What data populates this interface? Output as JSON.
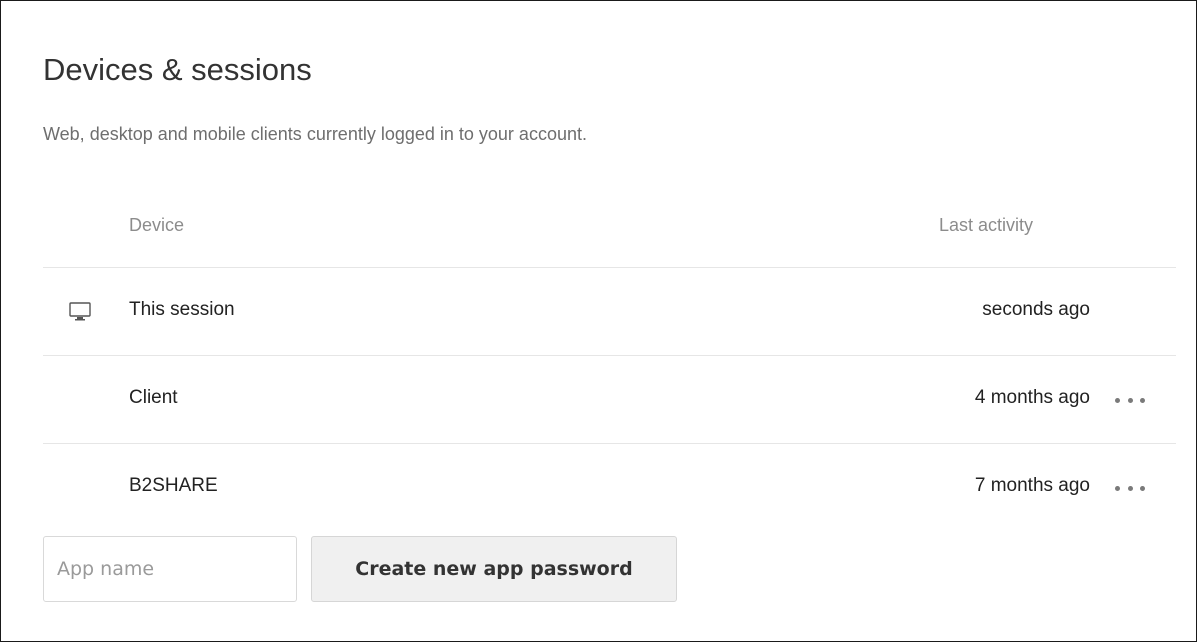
{
  "section": {
    "title": "Devices & sessions",
    "description": "Web, desktop and mobile clients currently logged in to your account."
  },
  "table": {
    "headers": {
      "device": "Device",
      "last_activity": "Last activity"
    },
    "rows": [
      {
        "device": "This session",
        "last_activity": "seconds ago",
        "icon": "monitor-icon",
        "has_actions": false
      },
      {
        "device": "Client",
        "last_activity": "4 months ago",
        "icon": null,
        "has_actions": true
      },
      {
        "device": "B2SHARE",
        "last_activity": "7 months ago",
        "icon": null,
        "has_actions": true
      }
    ]
  },
  "app_password": {
    "input_placeholder": "App name",
    "input_value": "",
    "button_label": "Create new app password"
  },
  "colors": {
    "title": "#333333",
    "muted": "#6e6e6e",
    "header_text": "#8c8c8c",
    "divider": "#e6e6e6",
    "button_bg": "#f0f0f0"
  }
}
